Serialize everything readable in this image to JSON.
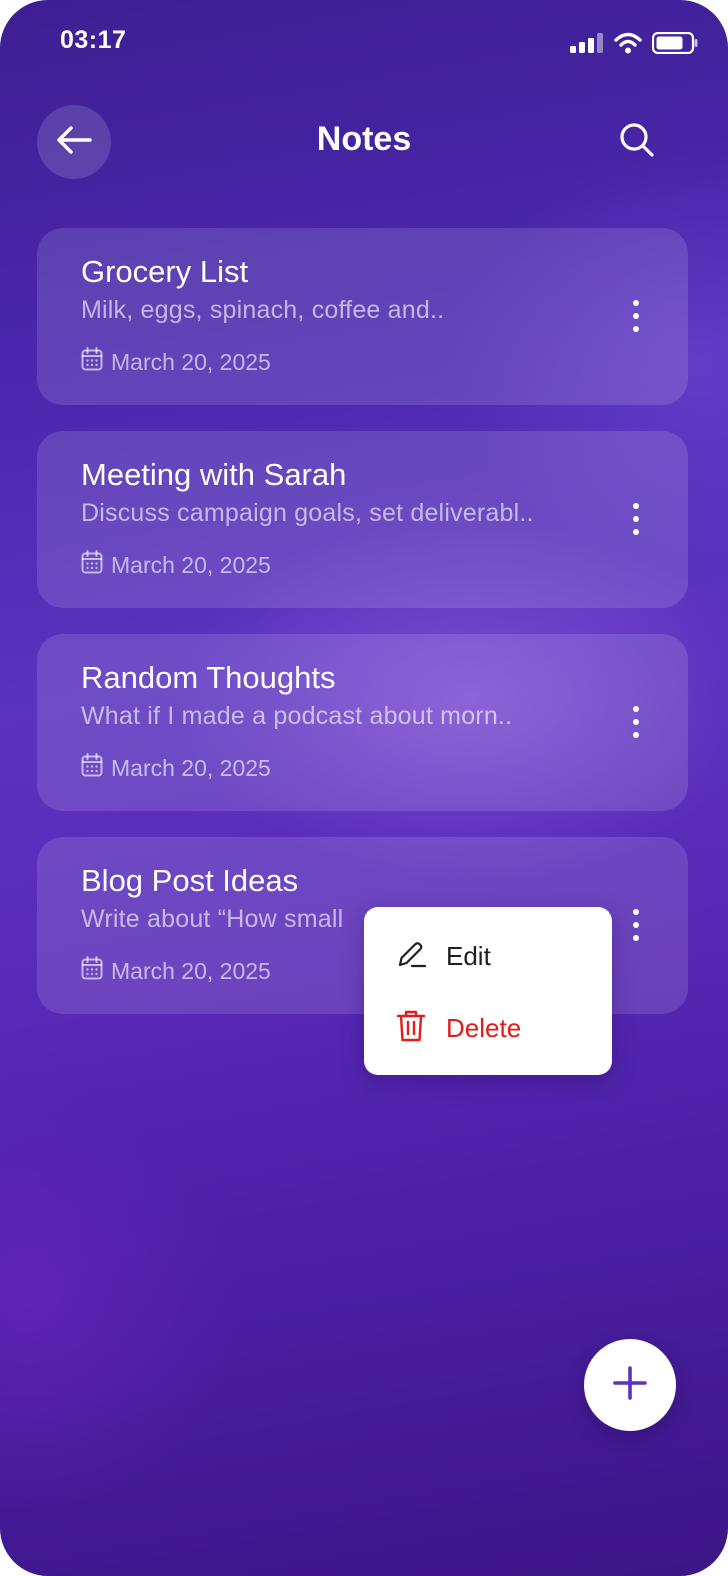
{
  "status_bar": {
    "time": "03:17",
    "icons": [
      "signal-icon",
      "wifi-icon",
      "battery-icon"
    ]
  },
  "header": {
    "title": "Notes",
    "back_icon": "arrow-left-icon",
    "search_icon": "search-icon"
  },
  "notes": [
    {
      "title": "Grocery List",
      "preview": "Milk, eggs, spinach, coffee and..",
      "date": "March 20, 2025"
    },
    {
      "title": "Meeting with Sarah",
      "preview": "Discuss campaign goals, set deliverabl..",
      "date": "March 20, 2025"
    },
    {
      "title": "Random Thoughts",
      "preview": "What if I made a podcast about morn..",
      "date": "March 20, 2025"
    },
    {
      "title": "Blog Post Ideas",
      "preview": "Write about “How small",
      "date": "March 20, 2025"
    }
  ],
  "context_menu": {
    "edit_label": "Edit",
    "delete_label": "Delete"
  },
  "fab": {
    "icon": "plus-icon"
  },
  "colors": {
    "background_top": "#3e1f92",
    "background_mid": "#5a33bf",
    "background_bottom": "#3c1585",
    "accent_purple": "#5b34b8",
    "delete_red": "#e21b1b",
    "menu_bg": "#ffffff"
  }
}
